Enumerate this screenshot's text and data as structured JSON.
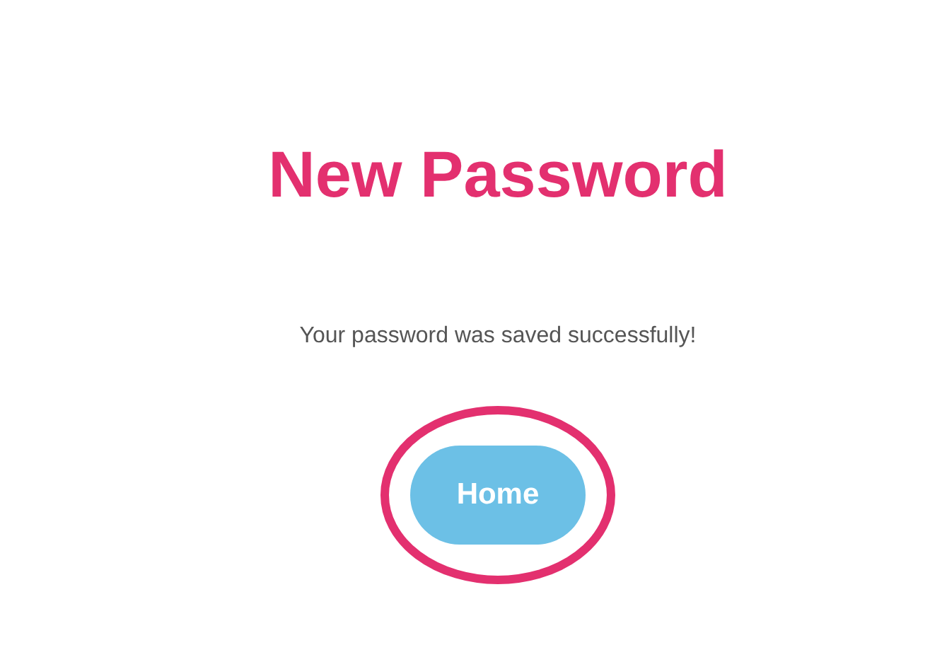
{
  "title": "New Password",
  "message": "Your password was saved successfully!",
  "button": {
    "label": "Home"
  },
  "annotation": {
    "kind": "ellipse",
    "color": "#e3306f"
  }
}
